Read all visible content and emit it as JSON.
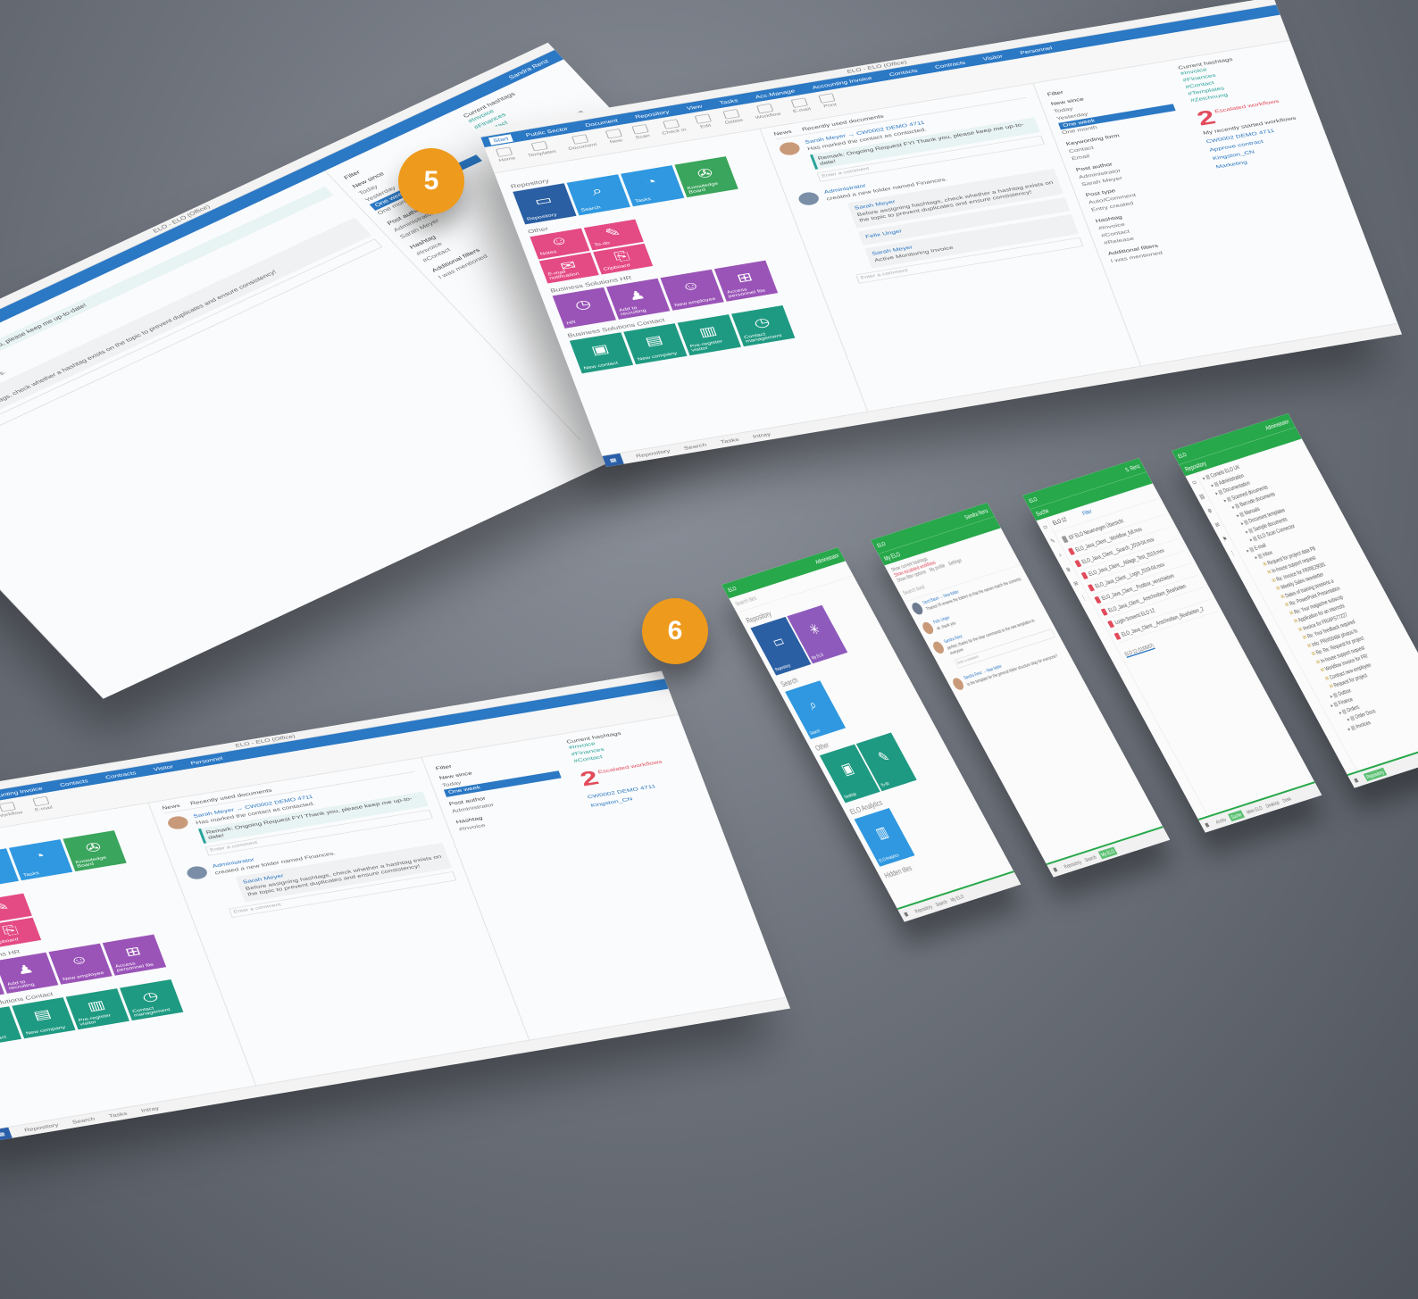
{
  "markers": {
    "desktop_step": "5",
    "mobile_step": "6"
  },
  "colors": {
    "desktop_blue": "#2b78c4",
    "mobile_green": "#27a84a",
    "badge_orange": "#ee9a1c"
  },
  "desktop": {
    "title": "ELO - ELO (Office)",
    "tabs": [
      "Start",
      "Public Sector",
      "Document",
      "Repository",
      "View",
      "Tasks",
      "Acc.Manage",
      "Accounting Invoice",
      "Contacts",
      "Contracts",
      "Visitor",
      "Personnel"
    ],
    "user": "Sandra Renz",
    "ribbon": [
      "Home",
      "Templates",
      "Document",
      "New",
      "Scan",
      "Check in",
      "Edit",
      "Delete",
      "Workflow",
      "E-mail",
      "Print"
    ],
    "sections": {
      "repository": "Repository",
      "other": "Other",
      "hr": "Business Solutions HR",
      "contact": "Business Solutions Contact"
    },
    "tiles_repository": [
      {
        "label": "Repository",
        "icon": "▭",
        "color": "#2a5fa3"
      },
      {
        "label": "Search",
        "icon": "⌕",
        "color": "#2f98e0"
      },
      {
        "label": "Tasks",
        "icon": "◔",
        "color": "#2f98e0"
      },
      {
        "label": "Knowledge Board",
        "icon": "✇",
        "color": "#3aa55c"
      }
    ],
    "tiles_other": [
      {
        "label": "Notes",
        "icon": "☺",
        "color": "#e44a84"
      },
      {
        "label": "To-do",
        "icon": "✎",
        "color": "#e44a84"
      },
      {
        "label": "E-mail notification",
        "icon": "✉",
        "color": "#e44a84"
      },
      {
        "label": "Clipboard",
        "icon": "⎘",
        "color": "#e44a84"
      }
    ],
    "tiles_hr": [
      {
        "label": "HR",
        "icon": "◷",
        "color": "#9a54b8"
      },
      {
        "label": "Add to recruiting",
        "icon": "♟",
        "color": "#9a54b8"
      },
      {
        "label": "New employee",
        "icon": "☺",
        "color": "#9a54b8"
      },
      {
        "label": "Access personnel file",
        "icon": "⊞",
        "color": "#9a54b8"
      }
    ],
    "tiles_contact": [
      {
        "label": "New contact",
        "icon": "▣",
        "color": "#1f9a82"
      },
      {
        "label": "New company",
        "icon": "▤",
        "color": "#1f9a82"
      },
      {
        "label": "Pre-register visitor",
        "icon": "▥",
        "color": "#1f9a82"
      },
      {
        "label": "Contact management",
        "icon": "◷",
        "color": "#1f9a82"
      }
    ],
    "feed_tabs": [
      "News",
      "Recently used documents"
    ],
    "posts": [
      {
        "author": "Sarah Meyer → CW0002 DEMO 4711",
        "text": "Has marked the contact as contacted.",
        "highlight": "Remark: Ongoing Request FYI Thank you, please keep me up-to-date!"
      },
      {
        "author": "Administrator",
        "text": "created a new folder named Finances."
      },
      {
        "author": "Sarah Meyer",
        "text": "Before assigning hashtags, check whether a hashtag exists on the topic to prevent duplicates and ensure consistency!"
      },
      {
        "author": "Felix Unger",
        "text": "@Sandra Renz"
      },
      {
        "author": "Sarah Meyer",
        "text": "Active Monitoring Invoice"
      }
    ],
    "comment_placeholder": "Enter a comment",
    "filters": {
      "title": "Filter",
      "groups": [
        {
          "head": "New since",
          "items": [
            "Today",
            "Yesterday",
            "One week",
            "One month"
          ],
          "selected": 2
        },
        {
          "head": "Keywording form",
          "items": [
            "Contact",
            "Email"
          ]
        },
        {
          "head": "Post author",
          "items": [
            "Administrator",
            "Sarah Meyer"
          ]
        },
        {
          "head": "Post type",
          "items": [
            "Auto/Comment",
            "Entry created"
          ]
        },
        {
          "head": "Hashtag",
          "items": [
            "#Invoice",
            "#Contact",
            "#Release"
          ]
        },
        {
          "head": "Additional filters",
          "items": [
            "I was mentioned"
          ]
        }
      ]
    },
    "right": {
      "hashtags_title": "Current hashtags",
      "hashtags": [
        "#Invoice",
        "#Finances",
        "#Contact",
        "#Templates",
        "#Zeichnung"
      ],
      "escalated_count": "2",
      "escalated_label": "Escalated workflows",
      "started_title": "My recently started workflows",
      "workflows": [
        "CW0002 DEMO 4711",
        "Approve contract",
        "Kingston_CN",
        "Marketing"
      ]
    },
    "status": [
      "Repository",
      "Search",
      "Tasks",
      "Intray"
    ]
  },
  "mobile": {
    "tiles_app": {
      "header": "ELO",
      "user": "Administrator",
      "search": "Search tiles",
      "sections": [
        "Repository",
        "Search",
        "Other",
        "ELO Analytics",
        "Hidden tiles"
      ],
      "tiles": [
        {
          "label": "Repository",
          "icon": "▭",
          "color": "#2a5fa3"
        },
        {
          "label": "My ELO",
          "icon": "✳",
          "color": "#8e5bbd"
        },
        {
          "label": "Search",
          "icon": "⌕",
          "color": "#2f98e0"
        },
        {
          "label": "Desktop",
          "icon": "▣",
          "color": "#1f9a82"
        },
        {
          "label": "To-do",
          "icon": "✎",
          "color": "#1f9a82"
        },
        {
          "label": "ELO Analytics",
          "icon": "▥",
          "color": "#2f98e0"
        }
      ],
      "bottom": [
        "Repository",
        "Search",
        "My ELO"
      ]
    },
    "feed_app": {
      "header": "ELO",
      "user": "Sandra Renz",
      "title": "My ELO",
      "actions": [
        "Show current hashtags",
        "Show escalated workflows",
        "My profile",
        "Settings",
        "Show filter options"
      ],
      "search": "Search feed",
      "posts": [
        {
          "author": "Gerd Baum → New folder",
          "text": "Thanks! I'll rename the folders so that the names match the contents."
        },
        {
          "author": "Felix Unger",
          "text": "ok. thank you"
        },
        {
          "author": "Sandra Renz",
          "text": "perfect, thanks for the clear commands to the new templates to everyone"
        },
        {
          "author": "Sandra Renz → New folder",
          "text": "Is the template for the general folder structure okay for everyone?"
        }
      ],
      "comment_placeholder": "Enter a comment",
      "bottom": [
        "Repository",
        "Search",
        "My ELO"
      ]
    },
    "search_app": {
      "header": "ELO",
      "user": "S. Renz",
      "title": "Suche",
      "query": "ELO 12",
      "filter": "Filter",
      "files": [
        "EF ELO Neuerungen Übersicht",
        "ELO_Java_Client__Workflow_full.mov",
        "ELO_Java_Client__Search_2019-04.mov",
        "ELO_Java_Client__Ablage_Test_2019.mov",
        "ELO_Java_Client__Login_2019-04.mov",
        "ELO_Java_Client__Postbox_verschieben",
        "ELO_Java_Client__Anschreiben_Bearbeiten",
        "Login-Screens ELO 12",
        "ELO_Java_Client__Anschreiben_Bearbeiten_2"
      ],
      "chip": "ELO 12 (11/05/07)",
      "bottom": [
        "Archiv",
        "Suche",
        "Mein ELO",
        "Desktop",
        "Desk"
      ]
    },
    "tree_app": {
      "header": "ELO",
      "user": "Administrator",
      "title": "Repository",
      "tree": [
        "Contelo ELO UK",
        "Administration",
        "Documentation",
        "Scanned documents",
        "Barcode documents",
        "Manuals",
        "Document templates",
        "Sample documents",
        "ELO Scan Connector",
        "E-mail",
        "Inbox",
        "Request for project data P8",
        "In-house support request",
        "Re: Invoice for FR/RE29091",
        "Weekly Sales newsletter",
        "Dates of training sessions a",
        "Re: PowerPoint Presentation",
        "Re: Your magazine subscrip",
        "Application for an internshi",
        "Invoice for FR/APS77227",
        "Re: Your feedback required",
        "Info: PR/#00484 photos fo",
        "Re: Re: Request for project",
        "In-house support request",
        "Workflow Invoice for FR/",
        "Contract new employee",
        "Request for project",
        "Outbox",
        "Finance",
        "Orders",
        "Order Docs",
        "Invoices"
      ],
      "bottom": [
        "Repository"
      ]
    }
  }
}
